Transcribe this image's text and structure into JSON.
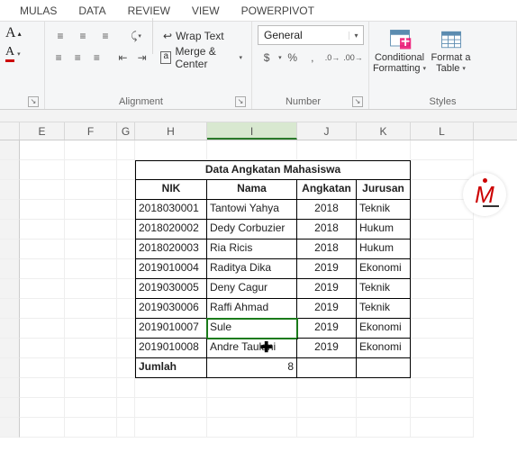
{
  "tabs": {
    "mulas": "MULAS",
    "data": "DATA",
    "review": "REVIEW",
    "view": "VIEW",
    "powerpivot": "POWERPIVOT"
  },
  "ribbon": {
    "wrap": "Wrap Text",
    "merge": "Merge & Center",
    "alignment": "Alignment",
    "numberFormat": "General",
    "number": "Number",
    "conditional": "Conditional Formatting",
    "formatTable": "Format a Table",
    "styles": "Styles",
    "currency": "$",
    "percent": "%",
    "comma": ",",
    "incDec": ".0",
    "decDec": ".00"
  },
  "cols": {
    "E": "E",
    "F": "F",
    "G": "G",
    "H": "H",
    "I": "I",
    "J": "J",
    "K": "K",
    "L": "L"
  },
  "table": {
    "title": "Data Angkatan Mahasiswa",
    "headers": {
      "nik": "NIK",
      "nama": "Nama",
      "angkatan": "Angkatan",
      "jurusan": "Jurusan"
    },
    "rows": [
      {
        "nik": "2018030001",
        "nama": "Tantowi Yahya",
        "ang": "2018",
        "jur": "Teknik"
      },
      {
        "nik": "2018020002",
        "nama": "Dedy Corbuzier",
        "ang": "2018",
        "jur": "Hukum"
      },
      {
        "nik": "2018020003",
        "nama": "Ria Ricis",
        "ang": "2018",
        "jur": "Hukum"
      },
      {
        "nik": "2019010004",
        "nama": "Raditya Dika",
        "ang": "2019",
        "jur": "Ekonomi"
      },
      {
        "nik": "2019030005",
        "nama": "Deny Cagur",
        "ang": "2019",
        "jur": "Teknik"
      },
      {
        "nik": "2019030006",
        "nama": "Raffi Ahmad",
        "ang": "2019",
        "jur": "Teknik"
      },
      {
        "nik": "2019010007",
        "nama": "Sule",
        "ang": "2019",
        "jur": "Ekonomi"
      },
      {
        "nik": "2019010008",
        "nama": "Andre Taulani",
        "ang": "2019",
        "jur": "Ekonomi"
      }
    ],
    "footer": {
      "label": "Jumlah",
      "value": "8"
    }
  },
  "logo": "M"
}
